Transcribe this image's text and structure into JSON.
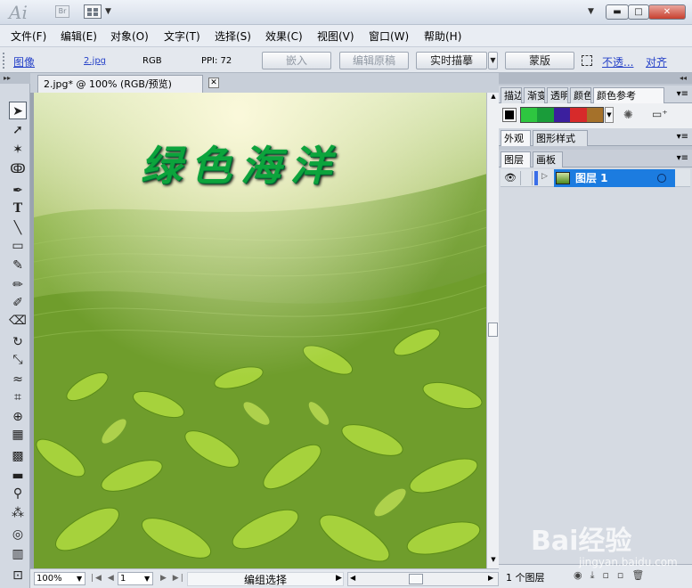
{
  "app": {
    "logo_text": "Ai",
    "bridge_label": "Br"
  },
  "menu": [
    "文件(F)",
    "编辑(E)",
    "对象(O)",
    "文字(T)",
    "选择(S)",
    "效果(C)",
    "视图(V)",
    "窗口(W)",
    "帮助(H)"
  ],
  "control": {
    "object_type": "图像",
    "file_name": "2.jpg",
    "color_mode": "RGB",
    "ppi": "PPI: 72",
    "embed": "嵌入",
    "edit_original": "编辑原稿",
    "live_trace": "实时描摹",
    "mask": "蒙版",
    "opacity_link": "不透...",
    "align_link": "对齐"
  },
  "document": {
    "tab_title": "2.jpg* @ 100% (RGB/预览)",
    "canvas_title": "绿色海洋",
    "zoom": "100%",
    "page": "1",
    "status": "编组选择"
  },
  "panels": {
    "group1_tabs": [
      "描边",
      "渐变",
      "透明",
      "颜色",
      "颜色参考"
    ],
    "group2_tabs": [
      "外观",
      "图形样式"
    ],
    "group3_tabs": [
      "图层",
      "画板"
    ],
    "swatches": [
      "#2ec640",
      "#1a9c3a",
      "#3b1f9e",
      "#d72a2a",
      "#a5712a"
    ],
    "layer_name": "图层 1",
    "layer_count": "1 个图层"
  },
  "watermark": {
    "brand": "Bai经验",
    "url": "jingyan.baidu.com"
  }
}
